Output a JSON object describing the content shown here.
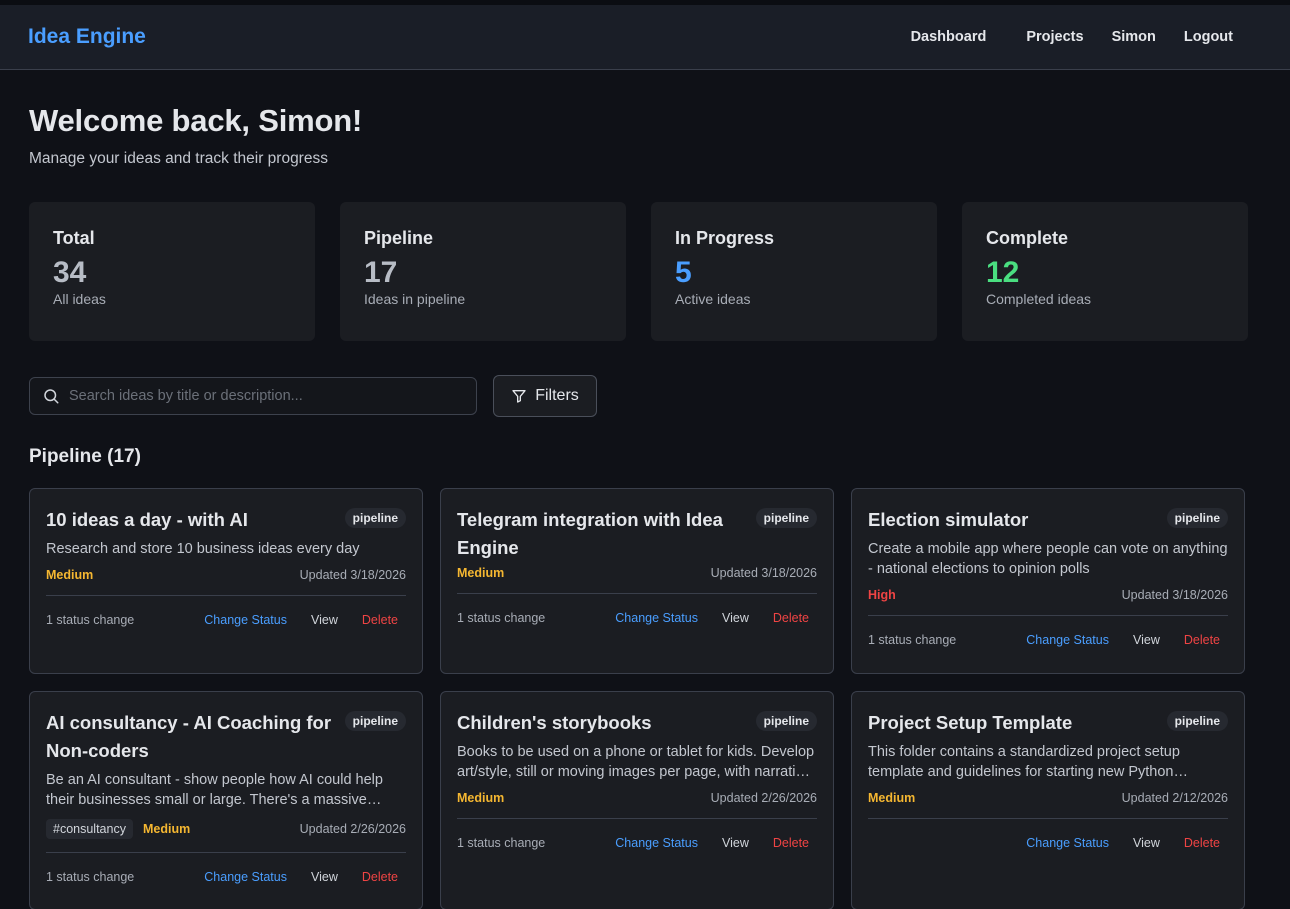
{
  "app": {
    "title": "Idea Engine"
  },
  "nav": {
    "dashboard": "Dashboard",
    "projects": "Projects",
    "user": "Simon",
    "logout": "Logout"
  },
  "welcome": {
    "heading": "Welcome back, Simon!",
    "subtitle": "Manage your ideas and track their progress"
  },
  "stats": [
    {
      "title": "Total",
      "value": "34",
      "sub": "All ideas",
      "color": "#b7bcc5"
    },
    {
      "title": "Pipeline",
      "value": "17",
      "sub": "Ideas in pipeline",
      "color": "#b7bcc5"
    },
    {
      "title": "In Progress",
      "value": "5",
      "sub": "Active ideas",
      "color": "#4a9eff"
    },
    {
      "title": "Complete",
      "value": "12",
      "sub": "Completed ideas",
      "color": "#4ade80"
    }
  ],
  "search": {
    "placeholder": "Search ideas by title or description...",
    "value": ""
  },
  "filters": {
    "label": "Filters"
  },
  "section": {
    "title": "Pipeline (17)"
  },
  "colors": {
    "medium": "#f5b731",
    "high": "#ef4444",
    "accent": "#4a9eff",
    "delete": "#ef4444"
  },
  "cards": [
    {
      "title": "10 ideas a day - with AI",
      "badge": "pipeline",
      "desc": "Research and store 10 business ideas every day",
      "tag": "",
      "priority": "Medium",
      "priority_level": "medium",
      "updated": "Updated 3/18/2026",
      "changes": "1 status change",
      "change_label": "Change Status",
      "view_label": "View",
      "delete_label": "Delete"
    },
    {
      "title": "Telegram integration with Idea Engine",
      "badge": "pipeline",
      "desc": "",
      "tag": "",
      "priority": "Medium",
      "priority_level": "medium",
      "updated": "Updated 3/18/2026",
      "changes": "1 status change",
      "change_label": "Change Status",
      "view_label": "View",
      "delete_label": "Delete"
    },
    {
      "title": "Election simulator",
      "badge": "pipeline",
      "desc": "Create a mobile app where people can vote on anything - national elections to opinion polls",
      "tag": "",
      "priority": "High",
      "priority_level": "high",
      "updated": "Updated 3/18/2026",
      "changes": "1 status change",
      "change_label": "Change Status",
      "view_label": "View",
      "delete_label": "Delete"
    },
    {
      "title": "AI consultancy - AI Coaching for Non-coders",
      "badge": "pipeline",
      "desc": "Be an AI consultant - show people how AI could help their businesses small or large. There's a massive opportunity for people who understand it well.",
      "tag": "#consultancy",
      "priority": "Medium",
      "priority_level": "medium",
      "updated": "Updated 2/26/2026",
      "changes": "1 status change",
      "change_label": "Change Status",
      "view_label": "View",
      "delete_label": "Delete"
    },
    {
      "title": "Children's storybooks",
      "badge": "pipeline",
      "desc": "Books to be used on a phone or tablet for kids. Develop art/style, still or moving images per page, with narration and sound effects.",
      "tag": "",
      "priority": "Medium",
      "priority_level": "medium",
      "updated": "Updated 2/26/2026",
      "changes": "1 status change",
      "change_label": "Change Status",
      "view_label": "View",
      "delete_label": "Delete"
    },
    {
      "title": "Project Setup Template",
      "badge": "pipeline",
      "desc": "This folder contains a standardized project setup template and guidelines for starting new Python projects with consistent structure.",
      "tag": "",
      "priority": "Medium",
      "priority_level": "medium",
      "updated": "Updated 2/12/2026",
      "changes": "",
      "change_label": "Change Status",
      "view_label": "View",
      "delete_label": "Delete"
    }
  ]
}
